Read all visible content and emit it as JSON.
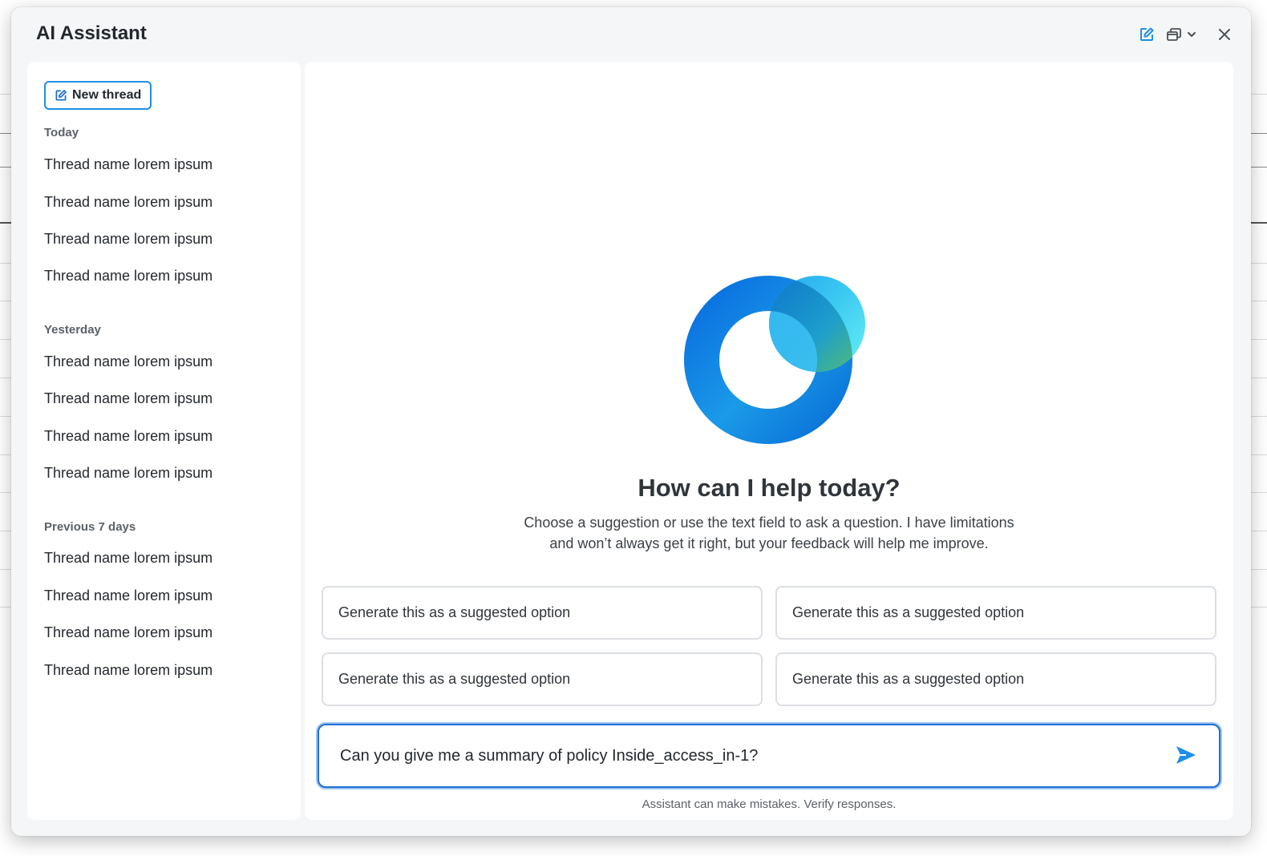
{
  "window": {
    "title": "AI Assistant",
    "actions": [
      {
        "name": "new-thread-icon",
        "label": "New thread"
      },
      {
        "name": "window-layout-icon",
        "label": "Window layout"
      },
      {
        "name": "close-icon",
        "label": "Close"
      }
    ]
  },
  "sidebar": {
    "new_thread_label": "New thread",
    "groups": [
      {
        "label": "Today",
        "threads": [
          "Thread name lorem ipsum",
          "Thread name lorem ipsum",
          "Thread name lorem ipsum",
          "Thread name lorem ipsum"
        ]
      },
      {
        "label": "Yesterday",
        "threads": [
          "Thread name lorem ipsum",
          "Thread name lorem ipsum",
          "Thread name lorem ipsum",
          "Thread name lorem ipsum"
        ]
      },
      {
        "label": "Previous 7 days",
        "threads": [
          "Thread name lorem ipsum",
          "Thread name lorem ipsum",
          "Thread name lorem ipsum",
          "Thread name lorem ipsum"
        ]
      }
    ]
  },
  "main": {
    "heading": "How can I help today?",
    "subtitle_line1": "Choose a suggestion or use the text field to ask a question. I have limitations",
    "subtitle_line2": "and won’t always get it right, but your feedback will help me improve.",
    "suggestions": [
      "Generate this as a suggested option",
      "Generate this as a suggested option",
      "Generate this as a suggested option",
      "Generate this as a suggested option"
    ],
    "input_value": "Can you give me a summary of policy Inside_access_in-1?",
    "send_icon": "send-icon",
    "disclaimer": "Assistant can make mistakes. Verify responses."
  },
  "colors": {
    "accent": "#1e90e0",
    "input_border": "#1f6fd4",
    "panel_bg": "#f5f6f7"
  }
}
